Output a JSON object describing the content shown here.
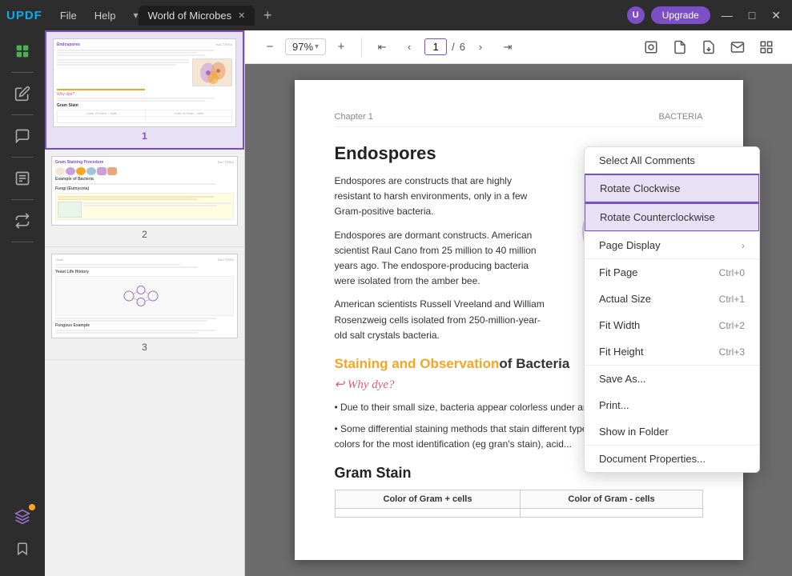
{
  "app": {
    "logo": "UPDF",
    "menus": [
      "File",
      "Help"
    ],
    "tab_title": "World of Microbes",
    "upgrade_label": "Upgrade",
    "upgrade_avatar": "U",
    "win_buttons": [
      "—",
      "□",
      "✕"
    ]
  },
  "toolbar": {
    "zoom_value": "97%",
    "page_current": "1",
    "page_total": "6"
  },
  "pdf": {
    "chapter": "Chapter 1",
    "chapter_right": "BACTERIA",
    "heading": "Endospores",
    "body1": "Endospores are constructs that are highly resistant to harsh environments, only in a few Gram-positive bacteria.",
    "body2": "Endospores are dormant constructs. American scientist Raul Cano from 25 million to 40 million years ago. The endospore-producing bacteria were isolated from the amber bee.",
    "body3": "American scientists Russell Vreeland and William Rosenzweig cells isolated from 250-million-year-old salt crystals bacteria.",
    "section2_heading_staining": "Staining and Observation",
    "section2_heading_rest": " of Bacteria",
    "why_dye": "Why dye?",
    "bullet1": "Due to their small size, bacteria appear colorless under an optic be dyed to see.",
    "bullet2": "Some differential staining methods that stain different types of bacteria with different colors for the most identification (eg gran's stain), acid...",
    "gram_heading": "Gram Stain",
    "gram_col1": "Color of Gram + cells",
    "gram_col2": "Color of Gram - cells"
  },
  "context_menu": {
    "item1": "Select All Comments",
    "item2": "Rotate Clockwise",
    "item3": "Rotate Counterclockwise",
    "item4": "Page Display",
    "item5": "Fit Page",
    "item5_shortcut": "Ctrl+0",
    "item6": "Actual Size",
    "item6_shortcut": "Ctrl+1",
    "item7": "Fit Width",
    "item7_shortcut": "Ctrl+2",
    "item8": "Fit Height",
    "item8_shortcut": "Ctrl+3",
    "item9": "Save As...",
    "item10": "Print...",
    "item11": "Show in Folder",
    "item12": "Document Properties..."
  },
  "thumbnails": [
    {
      "number": "1",
      "active": true
    },
    {
      "number": "2",
      "active": false
    },
    {
      "number": "3",
      "active": false
    }
  ]
}
